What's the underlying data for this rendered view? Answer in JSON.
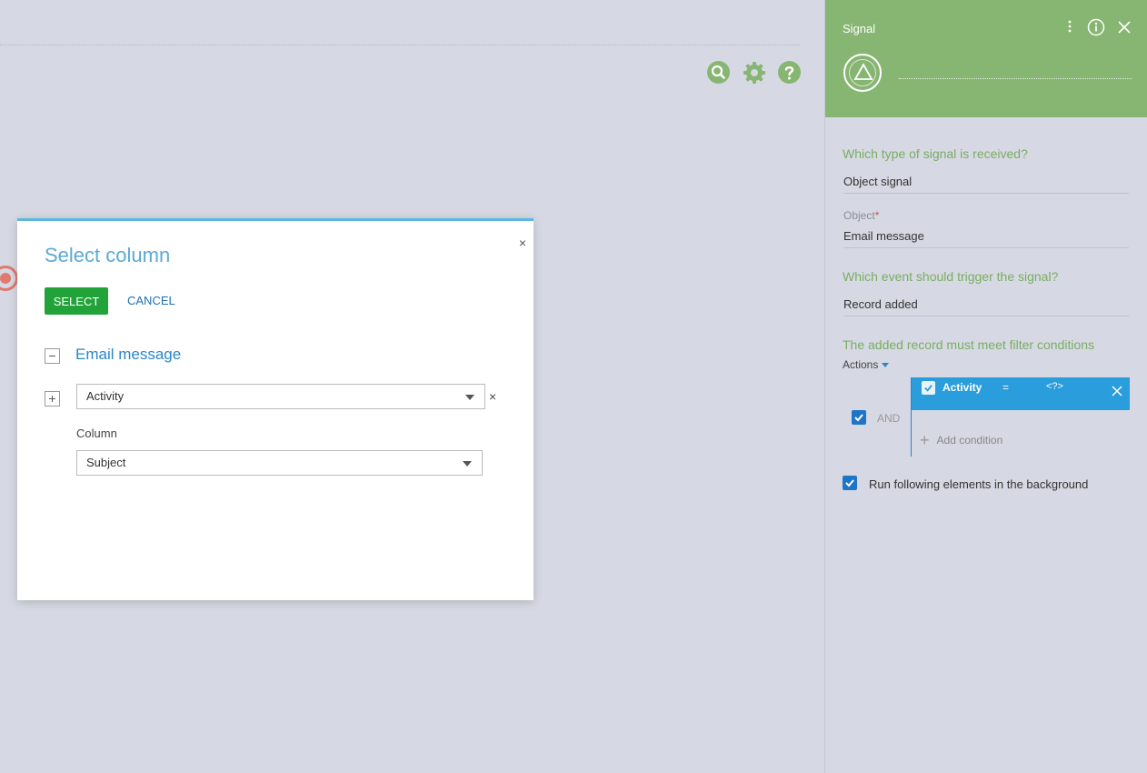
{
  "toolbar": {
    "search_icon": "search-icon",
    "settings_icon": "gear-icon",
    "help_icon": "help-icon",
    "accent": "#87b572"
  },
  "modal": {
    "title": "Select column",
    "close": "×",
    "select_label": "SELECT",
    "cancel_label": "CANCEL",
    "root_toggle": "−",
    "root_label": "Email message",
    "child_toggle": "+",
    "path_value": "Activity",
    "clear": "×",
    "column_caption": "Column",
    "column_value": "Subject",
    "colors": {
      "title": "#5aa9d6",
      "select_bg": "#22a33a",
      "top_border": "#5cb8e0"
    }
  },
  "panel": {
    "title": "Signal",
    "header_color": "#87b572",
    "q_signal_type": "Which type of signal is received?",
    "signal_type_value": "Object signal",
    "object_caption": "Object",
    "required_mark": "*",
    "object_value": "Email message",
    "q_event": "Which event should trigger the signal?",
    "event_value": "Record added",
    "q_filter": "The added record must meet filter conditions",
    "actions_label": "Actions",
    "group_operator": "AND",
    "condition": {
      "column": "Activity",
      "operator": "=",
      "value": "<?>",
      "color": "#2a9ddc"
    },
    "add_condition": "Add condition",
    "background_label": "Run following elements in the background"
  }
}
